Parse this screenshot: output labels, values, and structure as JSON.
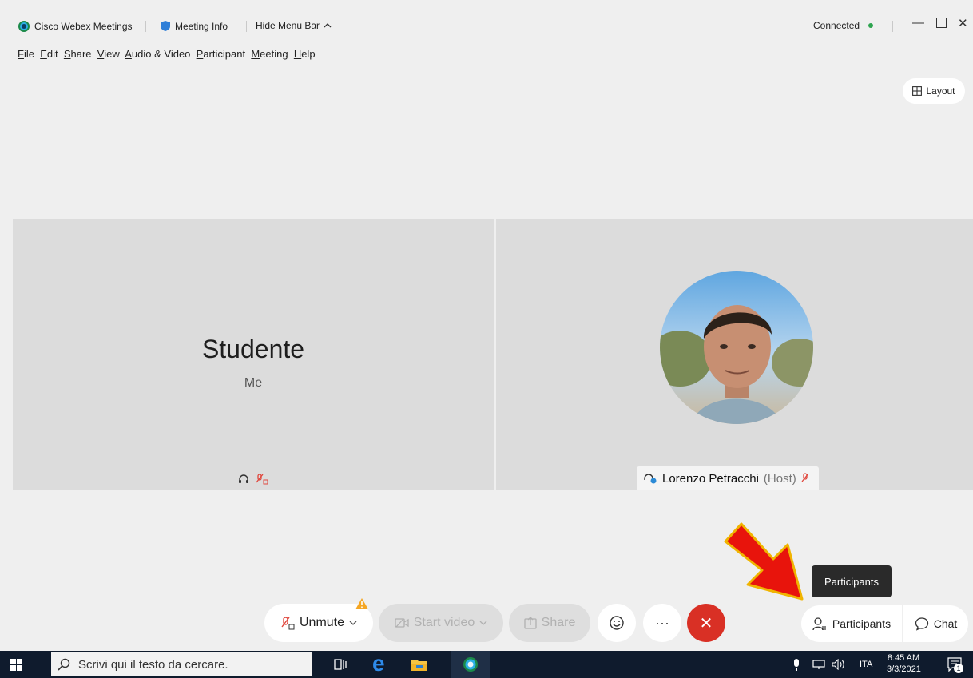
{
  "titlebar": {
    "app_name": "Cisco Webex Meetings",
    "meeting_info": "Meeting Info",
    "hide_menu": "Hide Menu Bar",
    "status": "Connected",
    "status_color": "#2ea44f"
  },
  "menu": [
    {
      "underline": "F",
      "rest": "ile"
    },
    {
      "underline": "E",
      "rest": "dit"
    },
    {
      "underline": "S",
      "rest": "hare"
    },
    {
      "underline": "V",
      "rest": "iew"
    },
    {
      "underline": "A",
      "rest": "udio & Video"
    },
    {
      "underline": "P",
      "rest": "articipant"
    },
    {
      "underline": "M",
      "rest": "eeting"
    },
    {
      "underline": "H",
      "rest": "elp"
    }
  ],
  "layout_button": "Layout",
  "self_tile": {
    "name": "Studente",
    "subtitle": "Me"
  },
  "host_tile": {
    "name": "Lorenzo Petracchi",
    "role": "(Host)"
  },
  "controls": {
    "unmute": "Unmute",
    "start_video": "Start video",
    "share": "Share",
    "more": "···",
    "participants": "Participants",
    "chat": "Chat",
    "tooltip": "Participants",
    "end_color": "#d93025",
    "warning_color": "#f5a623"
  },
  "taskbar": {
    "search_placeholder": "Scrivi qui il testo da cercare.",
    "language": "ITA",
    "time": "8:45 AM",
    "date": "3/3/2021",
    "notification_count": "1"
  },
  "annotation_arrow_color": "#e8140c"
}
